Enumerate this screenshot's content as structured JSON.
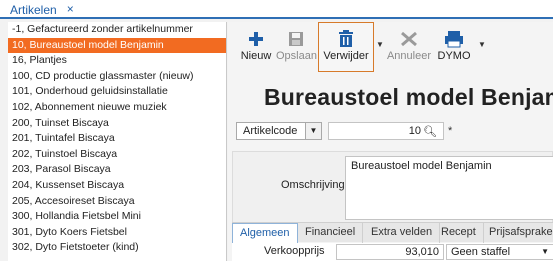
{
  "tab": {
    "label": "Artikelen",
    "close": "×"
  },
  "list": {
    "items": [
      "-1, Gefactureerd zonder artikelnummer",
      "10, Bureaustoel model Benjamin",
      "16, Plantjes",
      "100, CD productie glassmaster (nieuw)",
      "101, Onderhoud geluidsinstallatie",
      "102, Abonnement nieuwe muziek",
      "200, Tuinset Biscaya",
      "201, Tuintafel Biscaya",
      "202, Tuinstoel Biscaya",
      "203, Parasol Biscaya",
      "204, Kussenset Biscaya",
      "205, Accesoireset Biscaya",
      "300, Hollandia Fietsbel Mini",
      "301, Dyto Koers Fietsbel",
      "302, Dyto Fietstoeter (kind)"
    ],
    "selected_index": 1
  },
  "toolbar": {
    "nieuw": "Nieuw",
    "opslaan": "Opslaan",
    "verwijder": "Verwijder",
    "annuleer": "Annuleer",
    "dymo": "DYMO"
  },
  "record": {
    "title": "Bureaustoel model Benjamin",
    "color": "#f26b21"
  },
  "key": {
    "field": "Artikelcode",
    "value": "10",
    "required": "*"
  },
  "omschrijving": {
    "label": "Omschrijving",
    "value": "Bureaustoel model Benjamin"
  },
  "tabs": [
    "Algemeen",
    "Financieel",
    "Extra velden",
    "Recept",
    "Prijsafsprake"
  ],
  "verkoopprijs": {
    "label": "Verkoopprijs",
    "value": "93,010",
    "staffel": "Geen staffel"
  }
}
